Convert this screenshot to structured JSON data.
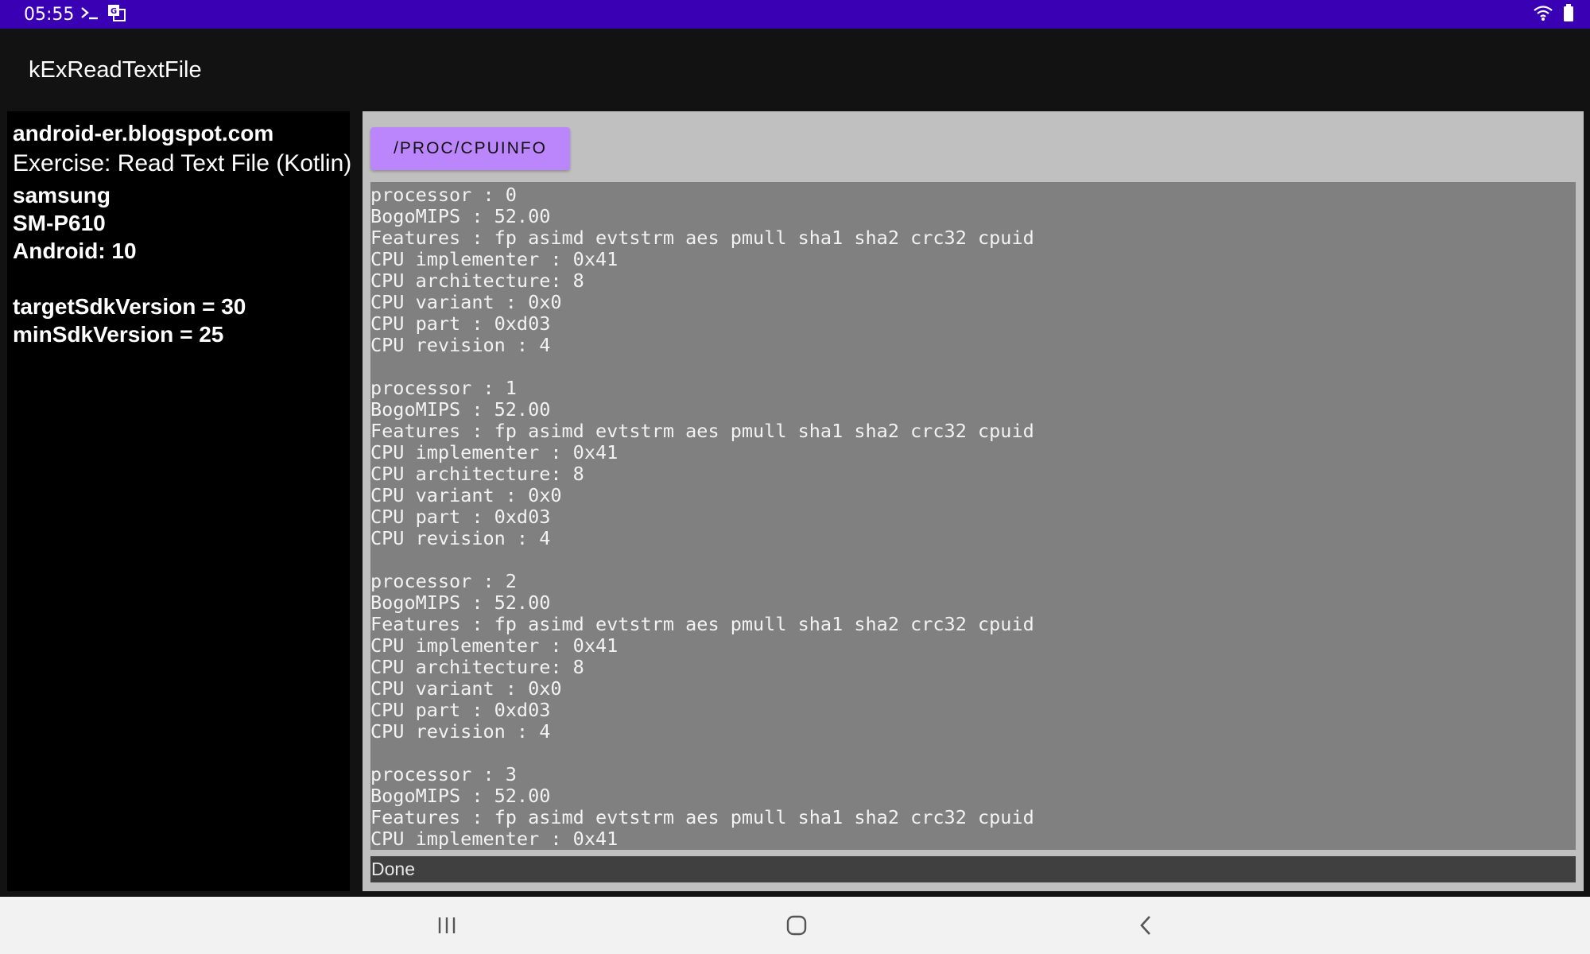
{
  "status_bar": {
    "time": "05:55",
    "icons": [
      "terminal-icon",
      "translate-icon",
      "wifi-icon",
      "battery-icon"
    ]
  },
  "app_bar": {
    "title": "kExReadTextFile"
  },
  "left_panel": {
    "site": "android-er.blogspot.com",
    "exercise": "Exercise: Read Text File (Kotlin)",
    "device_info": "samsung\nSM-P610\nAndroid: 10\n\ntargetSdkVersion = 30\nminSdkVersion = 25"
  },
  "right_panel": {
    "button_label": "/PROC/CPUINFO",
    "output": "processor : 0\nBogoMIPS : 52.00\nFeatures : fp asimd evtstrm aes pmull sha1 sha2 crc32 cpuid\nCPU implementer : 0x41\nCPU architecture: 8\nCPU variant : 0x0\nCPU part : 0xd03\nCPU revision : 4\n\nprocessor : 1\nBogoMIPS : 52.00\nFeatures : fp asimd evtstrm aes pmull sha1 sha2 crc32 cpuid\nCPU implementer : 0x41\nCPU architecture: 8\nCPU variant : 0x0\nCPU part : 0xd03\nCPU revision : 4\n\nprocessor : 2\nBogoMIPS : 52.00\nFeatures : fp asimd evtstrm aes pmull sha1 sha2 crc32 cpuid\nCPU implementer : 0x41\nCPU architecture: 8\nCPU variant : 0x0\nCPU part : 0xd03\nCPU revision : 4\n\nprocessor : 3\nBogoMIPS : 52.00\nFeatures : fp asimd evtstrm aes pmull sha1 sha2 crc32 cpuid\nCPU implementer : 0x41",
    "status": "Done"
  },
  "nav_bar": {
    "buttons": [
      "recents-icon",
      "home-icon",
      "back-icon"
    ]
  },
  "colors": {
    "status_bar": "#3a00b4",
    "button": "#bb86fc",
    "output_bg": "#808080",
    "panel_bg": "#c0c0c0"
  }
}
